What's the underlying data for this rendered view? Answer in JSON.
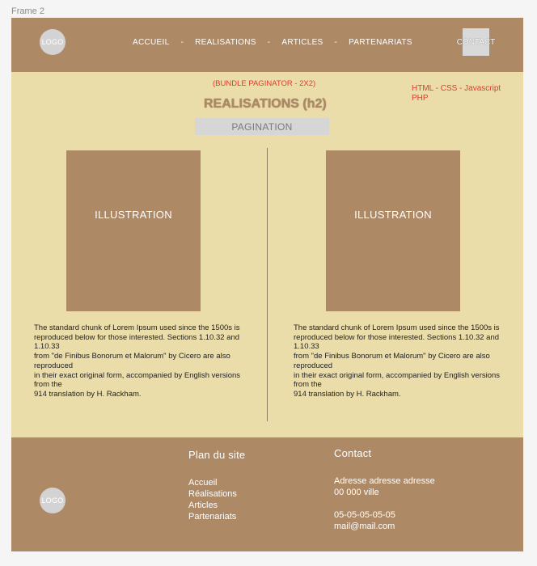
{
  "frame_label": "Frame 2",
  "header": {
    "logo": "LOGO",
    "nav": [
      {
        "label": "ACCUEIL"
      },
      {
        "label": "REALISATIONS"
      },
      {
        "label": "ARTICLES"
      },
      {
        "label": "PARTENARIATS"
      }
    ],
    "nav_separator": "-",
    "contact_button": "CONTACT"
  },
  "main": {
    "annotation_top": "(BUNDLE PAGINATOR - 2X2)",
    "annotation_tech": "HTML - CSS - Javascript\nPHP",
    "title": "REALISATIONS (h2)",
    "pagination": "PAGINATION",
    "cards": [
      {
        "illustration": "ILLUSTRATION",
        "text": "The standard chunk of Lorem Ipsum used since the 1500s is\nreproduced below for those interested. Sections 1.10.32 and 1.10.33\nfrom \"de Finibus Bonorum et Malorum\" by Cicero are also reproduced\nin their exact original form, accompanied by English versions from the\n914 translation by H. Rackham."
      },
      {
        "illustration": "ILLUSTRATION",
        "text": "The standard chunk of Lorem Ipsum used since the 1500s is\nreproduced below for those interested. Sections 1.10.32 and 1.10.33\nfrom \"de Finibus Bonorum et Malorum\" by Cicero are also reproduced\nin their exact original form, accompanied by English versions from the\n914 translation by H. Rackham."
      }
    ]
  },
  "footer": {
    "logo": "LOGO",
    "sitemap": {
      "heading": "Plan du site",
      "links": [
        "Accueil",
        "Réalisations",
        "Articles",
        "Partenariats"
      ]
    },
    "contact": {
      "heading": "Contact",
      "address_line1": "Adresse adresse adresse",
      "address_line2": "00 000 ville",
      "phone": "05-05-05-05-05",
      "email": "mail@mail.com"
    }
  },
  "colors": {
    "page_background": "#ebdda9",
    "brown": "#ae8965",
    "annotation_red": "#e03a2e",
    "pagination_gray": "#d6d6d6"
  }
}
